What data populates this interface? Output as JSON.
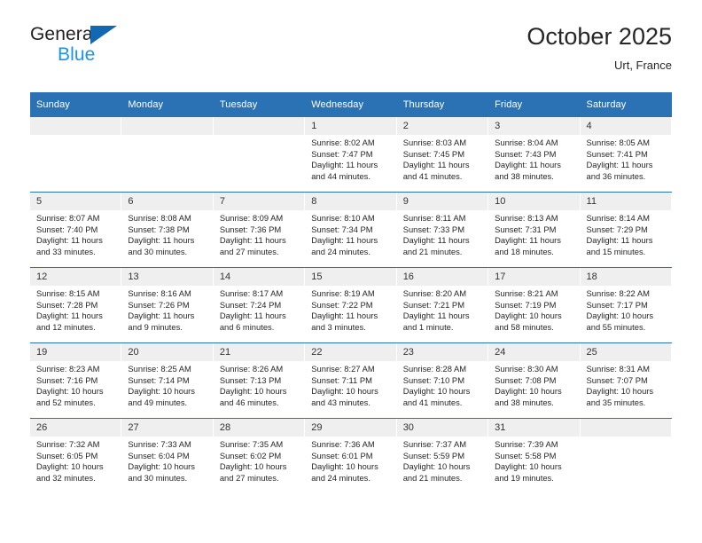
{
  "brand": {
    "name_line1": "General",
    "name_line2": "Blue",
    "triangle_color": "#1268b3",
    "blue_text_color": "#1c93e8"
  },
  "header": {
    "title": "October 2025",
    "subtitle": "Urt, France"
  },
  "theme": {
    "header_row_bg": "#2b72b4",
    "daynum_bg": "#efefef",
    "row_divider": "#2b72b4",
    "text": "#262626"
  },
  "calendar": {
    "weekday_headers": [
      "Sunday",
      "Monday",
      "Tuesday",
      "Wednesday",
      "Thursday",
      "Friday",
      "Saturday"
    ],
    "labels": {
      "sunrise": "Sunrise:",
      "sunset": "Sunset:",
      "daylight": "Daylight:"
    },
    "weeks": [
      [
        {
          "day": "",
          "empty": true
        },
        {
          "day": "",
          "empty": true
        },
        {
          "day": "",
          "empty": true
        },
        {
          "day": "1",
          "sunrise": "Sunrise: 8:02 AM",
          "sunset": "Sunset: 7:47 PM",
          "daylight1": "Daylight: 11 hours",
          "daylight2": "and 44 minutes."
        },
        {
          "day": "2",
          "sunrise": "Sunrise: 8:03 AM",
          "sunset": "Sunset: 7:45 PM",
          "daylight1": "Daylight: 11 hours",
          "daylight2": "and 41 minutes."
        },
        {
          "day": "3",
          "sunrise": "Sunrise: 8:04 AM",
          "sunset": "Sunset: 7:43 PM",
          "daylight1": "Daylight: 11 hours",
          "daylight2": "and 38 minutes."
        },
        {
          "day": "4",
          "sunrise": "Sunrise: 8:05 AM",
          "sunset": "Sunset: 7:41 PM",
          "daylight1": "Daylight: 11 hours",
          "daylight2": "and 36 minutes."
        }
      ],
      [
        {
          "day": "5",
          "sunrise": "Sunrise: 8:07 AM",
          "sunset": "Sunset: 7:40 PM",
          "daylight1": "Daylight: 11 hours",
          "daylight2": "and 33 minutes."
        },
        {
          "day": "6",
          "sunrise": "Sunrise: 8:08 AM",
          "sunset": "Sunset: 7:38 PM",
          "daylight1": "Daylight: 11 hours",
          "daylight2": "and 30 minutes."
        },
        {
          "day": "7",
          "sunrise": "Sunrise: 8:09 AM",
          "sunset": "Sunset: 7:36 PM",
          "daylight1": "Daylight: 11 hours",
          "daylight2": "and 27 minutes."
        },
        {
          "day": "8",
          "sunrise": "Sunrise: 8:10 AM",
          "sunset": "Sunset: 7:34 PM",
          "daylight1": "Daylight: 11 hours",
          "daylight2": "and 24 minutes."
        },
        {
          "day": "9",
          "sunrise": "Sunrise: 8:11 AM",
          "sunset": "Sunset: 7:33 PM",
          "daylight1": "Daylight: 11 hours",
          "daylight2": "and 21 minutes."
        },
        {
          "day": "10",
          "sunrise": "Sunrise: 8:13 AM",
          "sunset": "Sunset: 7:31 PM",
          "daylight1": "Daylight: 11 hours",
          "daylight2": "and 18 minutes."
        },
        {
          "day": "11",
          "sunrise": "Sunrise: 8:14 AM",
          "sunset": "Sunset: 7:29 PM",
          "daylight1": "Daylight: 11 hours",
          "daylight2": "and 15 minutes."
        }
      ],
      [
        {
          "day": "12",
          "sunrise": "Sunrise: 8:15 AM",
          "sunset": "Sunset: 7:28 PM",
          "daylight1": "Daylight: 11 hours",
          "daylight2": "and 12 minutes."
        },
        {
          "day": "13",
          "sunrise": "Sunrise: 8:16 AM",
          "sunset": "Sunset: 7:26 PM",
          "daylight1": "Daylight: 11 hours",
          "daylight2": "and 9 minutes."
        },
        {
          "day": "14",
          "sunrise": "Sunrise: 8:17 AM",
          "sunset": "Sunset: 7:24 PM",
          "daylight1": "Daylight: 11 hours",
          "daylight2": "and 6 minutes."
        },
        {
          "day": "15",
          "sunrise": "Sunrise: 8:19 AM",
          "sunset": "Sunset: 7:22 PM",
          "daylight1": "Daylight: 11 hours",
          "daylight2": "and 3 minutes."
        },
        {
          "day": "16",
          "sunrise": "Sunrise: 8:20 AM",
          "sunset": "Sunset: 7:21 PM",
          "daylight1": "Daylight: 11 hours",
          "daylight2": "and 1 minute."
        },
        {
          "day": "17",
          "sunrise": "Sunrise: 8:21 AM",
          "sunset": "Sunset: 7:19 PM",
          "daylight1": "Daylight: 10 hours",
          "daylight2": "and 58 minutes."
        },
        {
          "day": "18",
          "sunrise": "Sunrise: 8:22 AM",
          "sunset": "Sunset: 7:17 PM",
          "daylight1": "Daylight: 10 hours",
          "daylight2": "and 55 minutes."
        }
      ],
      [
        {
          "day": "19",
          "sunrise": "Sunrise: 8:23 AM",
          "sunset": "Sunset: 7:16 PM",
          "daylight1": "Daylight: 10 hours",
          "daylight2": "and 52 minutes."
        },
        {
          "day": "20",
          "sunrise": "Sunrise: 8:25 AM",
          "sunset": "Sunset: 7:14 PM",
          "daylight1": "Daylight: 10 hours",
          "daylight2": "and 49 minutes."
        },
        {
          "day": "21",
          "sunrise": "Sunrise: 8:26 AM",
          "sunset": "Sunset: 7:13 PM",
          "daylight1": "Daylight: 10 hours",
          "daylight2": "and 46 minutes."
        },
        {
          "day": "22",
          "sunrise": "Sunrise: 8:27 AM",
          "sunset": "Sunset: 7:11 PM",
          "daylight1": "Daylight: 10 hours",
          "daylight2": "and 43 minutes."
        },
        {
          "day": "23",
          "sunrise": "Sunrise: 8:28 AM",
          "sunset": "Sunset: 7:10 PM",
          "daylight1": "Daylight: 10 hours",
          "daylight2": "and 41 minutes."
        },
        {
          "day": "24",
          "sunrise": "Sunrise: 8:30 AM",
          "sunset": "Sunset: 7:08 PM",
          "daylight1": "Daylight: 10 hours",
          "daylight2": "and 38 minutes."
        },
        {
          "day": "25",
          "sunrise": "Sunrise: 8:31 AM",
          "sunset": "Sunset: 7:07 PM",
          "daylight1": "Daylight: 10 hours",
          "daylight2": "and 35 minutes."
        }
      ],
      [
        {
          "day": "26",
          "sunrise": "Sunrise: 7:32 AM",
          "sunset": "Sunset: 6:05 PM",
          "daylight1": "Daylight: 10 hours",
          "daylight2": "and 32 minutes."
        },
        {
          "day": "27",
          "sunrise": "Sunrise: 7:33 AM",
          "sunset": "Sunset: 6:04 PM",
          "daylight1": "Daylight: 10 hours",
          "daylight2": "and 30 minutes."
        },
        {
          "day": "28",
          "sunrise": "Sunrise: 7:35 AM",
          "sunset": "Sunset: 6:02 PM",
          "daylight1": "Daylight: 10 hours",
          "daylight2": "and 27 minutes."
        },
        {
          "day": "29",
          "sunrise": "Sunrise: 7:36 AM",
          "sunset": "Sunset: 6:01 PM",
          "daylight1": "Daylight: 10 hours",
          "daylight2": "and 24 minutes."
        },
        {
          "day": "30",
          "sunrise": "Sunrise: 7:37 AM",
          "sunset": "Sunset: 5:59 PM",
          "daylight1": "Daylight: 10 hours",
          "daylight2": "and 21 minutes."
        },
        {
          "day": "31",
          "sunrise": "Sunrise: 7:39 AM",
          "sunset": "Sunset: 5:58 PM",
          "daylight1": "Daylight: 10 hours",
          "daylight2": "and 19 minutes."
        },
        {
          "day": "",
          "empty": true
        }
      ]
    ]
  }
}
